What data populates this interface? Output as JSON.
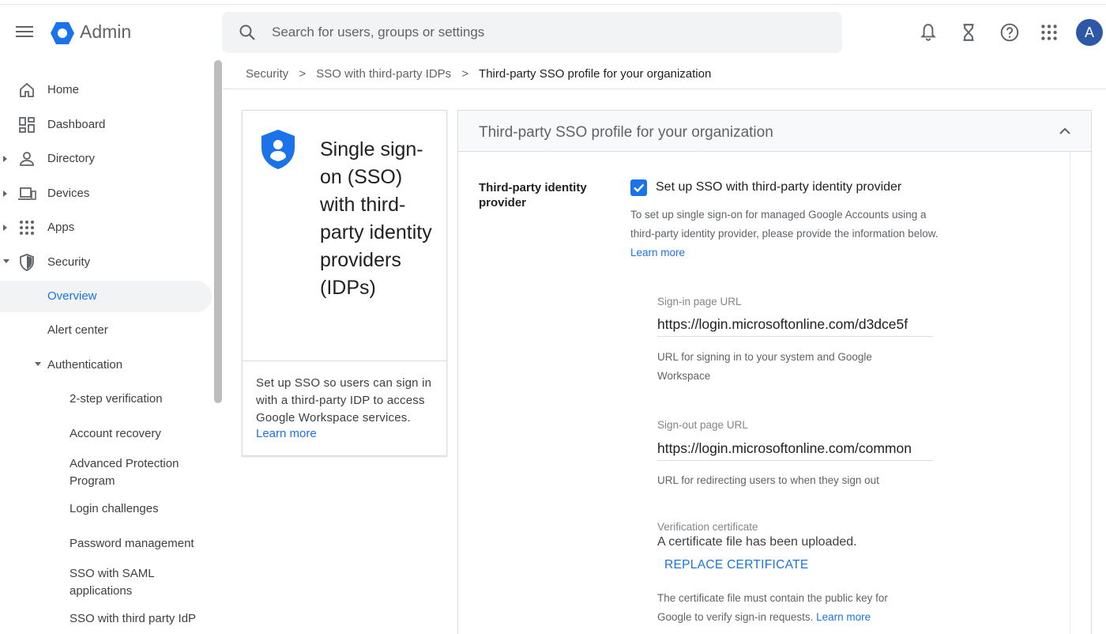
{
  "app": {
    "title": "Admin",
    "avatar_initial": "A",
    "accent_color": "#1a73e8"
  },
  "search": {
    "placeholder": "Search for users, groups or settings"
  },
  "header_icons": [
    "notifications-icon",
    "tasks-hourglass-icon",
    "help-icon",
    "apps-grid-icon"
  ],
  "sidebar": {
    "items": [
      {
        "label": "Home",
        "icon": "home-icon"
      },
      {
        "label": "Dashboard",
        "icon": "dashboard-icon"
      },
      {
        "label": "Directory",
        "icon": "person-icon",
        "expand": "collapsed"
      },
      {
        "label": "Devices",
        "icon": "devices-icon",
        "expand": "collapsed"
      },
      {
        "label": "Apps",
        "icon": "apps-grid-icon",
        "expand": "collapsed"
      },
      {
        "label": "Security",
        "icon": "shield-icon",
        "expand": "expanded"
      },
      {
        "label": "Overview",
        "active": true
      },
      {
        "label": "Alert center"
      },
      {
        "label": "Authentication",
        "expand": "expanded"
      },
      {
        "label": "2-step verification"
      },
      {
        "label": "Account recovery"
      },
      {
        "label": "Advanced Protection Program"
      },
      {
        "label": "Login challenges"
      },
      {
        "label": "Password management"
      },
      {
        "label": "SSO with SAML applications"
      },
      {
        "label": "SSO with third party IdP"
      }
    ]
  },
  "breadcrumb": {
    "items": [
      "Security",
      "SSO with third-party IDPs",
      "Third-party SSO profile for your organization"
    ],
    "separator": ">"
  },
  "info_card": {
    "heading": "Single sign-on (SSO) with third-party identity providers (IDPs)",
    "description": "Set up SSO so users can sign in with a third-party IDP to access Google Workspace services.",
    "learn_more": "Learn more"
  },
  "panel": {
    "title": "Third-party SSO profile for your organization",
    "field_label": "Third-party identity provider",
    "checkbox_label": "Set up SSO with third-party identity provider",
    "checkbox_checked": true,
    "helper_text": "To set up single sign-on for managed Google Accounts using a third-party identity provider, please provide the information below.",
    "helper_link": "Learn more",
    "signin": {
      "label": "Sign-in page URL",
      "value": "https://login.microsoftonline.com/d3dce5f",
      "help": "URL for signing in to your system and Google Workspace"
    },
    "signout": {
      "label": "Sign-out page URL",
      "value": "https://login.microsoftonline.com/common",
      "help": "URL for redirecting users to when they sign out"
    },
    "certificate": {
      "label": "Verification certificate",
      "status": "A certificate file has been uploaded.",
      "button": "REPLACE CERTIFICATE",
      "help": "The certificate file must contain the public key for Google to verify sign-in requests.",
      "help_link": "Learn more"
    }
  }
}
